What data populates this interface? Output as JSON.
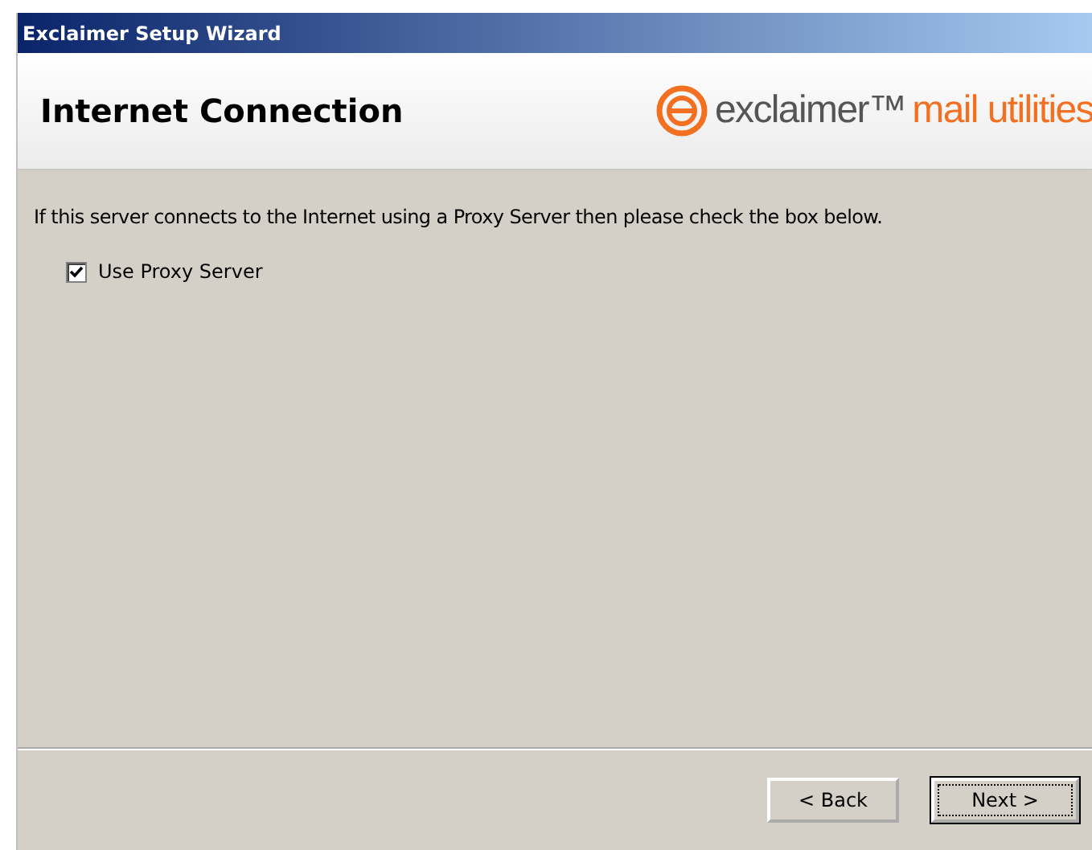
{
  "window": {
    "title": "Exclaimer Setup Wizard"
  },
  "header": {
    "title": "Internet Connection",
    "logo_brand": "exclaimer™",
    "logo_product": "mail utilities"
  },
  "instructions": "If this server connects to the Internet using a Proxy Server then please check the box below.",
  "options": [
    {
      "label": "Use Proxy Server",
      "checked": true
    }
  ],
  "buttons": [
    {
      "label": "< Back",
      "default": false
    },
    {
      "label": "Next >",
      "default": true
    }
  ]
}
